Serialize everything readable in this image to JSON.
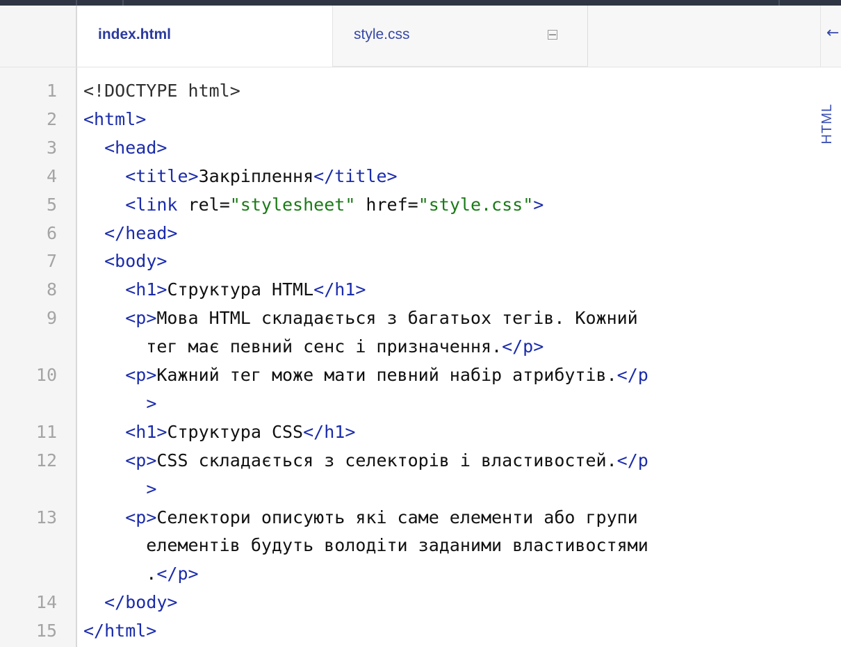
{
  "tabs": [
    {
      "label": "index.html",
      "active": true
    },
    {
      "label": "style.css",
      "active": false
    }
  ],
  "icons": {
    "collapse": "collapse-panel-icon",
    "arrow": "left-arrow-icon",
    "arrow_glyph": "←"
  },
  "language_label": "HTML",
  "colors": {
    "tag": "#1a2bab",
    "string": "#1b7a17",
    "text": "#111111",
    "line_number": "#a4a4a4"
  },
  "code": [
    {
      "num": "1",
      "parts": [
        [
          "d",
          "<!DOCTYPE html>"
        ]
      ]
    },
    {
      "num": "2",
      "parts": [
        [
          "t",
          "<html>"
        ]
      ]
    },
    {
      "num": "3",
      "parts": [
        [
          "x",
          "  "
        ],
        [
          "t",
          "<head>"
        ]
      ]
    },
    {
      "num": "4",
      "parts": [
        [
          "x",
          "    "
        ],
        [
          "t",
          "<title>"
        ],
        [
          "x",
          "Закріплення"
        ],
        [
          "t",
          "</title>"
        ]
      ]
    },
    {
      "num": "5",
      "parts": [
        [
          "x",
          "    "
        ],
        [
          "t",
          "<link"
        ],
        [
          "x",
          " rel="
        ],
        [
          "s",
          "\"stylesheet\""
        ],
        [
          "x",
          " href="
        ],
        [
          "s",
          "\"style.css\""
        ],
        [
          "t",
          ">"
        ]
      ]
    },
    {
      "num": "6",
      "parts": [
        [
          "x",
          "  "
        ],
        [
          "t",
          "</head>"
        ]
      ]
    },
    {
      "num": "7",
      "parts": [
        [
          "x",
          "  "
        ],
        [
          "t",
          "<body>"
        ]
      ]
    },
    {
      "num": "8",
      "parts": [
        [
          "x",
          "    "
        ],
        [
          "t",
          "<h1>"
        ],
        [
          "x",
          "Структура HTML"
        ],
        [
          "t",
          "</h1>"
        ]
      ]
    },
    {
      "num": "9",
      "parts": [
        [
          "x",
          "    "
        ],
        [
          "t",
          "<p>"
        ],
        [
          "x",
          "Мова HTML складається з багатьох тегів. Кожний"
        ]
      ]
    },
    {
      "num": "",
      "parts": [
        [
          "x",
          "      тег має певний сенс і призначення."
        ],
        [
          "t",
          "</p>"
        ]
      ]
    },
    {
      "num": "10",
      "parts": [
        [
          "x",
          "    "
        ],
        [
          "t",
          "<p>"
        ],
        [
          "x",
          "Кажний тег може мати певний набір атрибутів."
        ],
        [
          "t",
          "</p"
        ]
      ]
    },
    {
      "num": "",
      "parts": [
        [
          "x",
          "      "
        ],
        [
          "t",
          ">"
        ]
      ]
    },
    {
      "num": "11",
      "parts": [
        [
          "x",
          "    "
        ],
        [
          "t",
          "<h1>"
        ],
        [
          "x",
          "Структура CSS"
        ],
        [
          "t",
          "</h1>"
        ]
      ]
    },
    {
      "num": "12",
      "parts": [
        [
          "x",
          "    "
        ],
        [
          "t",
          "<p>"
        ],
        [
          "x",
          "CSS складається з селекторів і властивостей."
        ],
        [
          "t",
          "</p"
        ]
      ]
    },
    {
      "num": "",
      "parts": [
        [
          "x",
          "      "
        ],
        [
          "t",
          ">"
        ]
      ]
    },
    {
      "num": "13",
      "parts": [
        [
          "x",
          "    "
        ],
        [
          "t",
          "<p>"
        ],
        [
          "x",
          "Селектори описують які саме елементи або групи"
        ]
      ]
    },
    {
      "num": "",
      "parts": [
        [
          "x",
          "      елементів будуть володіти заданими властивостями"
        ]
      ]
    },
    {
      "num": "",
      "parts": [
        [
          "x",
          "      ."
        ],
        [
          "t",
          "</p>"
        ]
      ]
    },
    {
      "num": "14",
      "parts": [
        [
          "x",
          "  "
        ],
        [
          "t",
          "</body>"
        ]
      ]
    },
    {
      "num": "15",
      "parts": [
        [
          "t",
          "</html>"
        ]
      ]
    }
  ]
}
